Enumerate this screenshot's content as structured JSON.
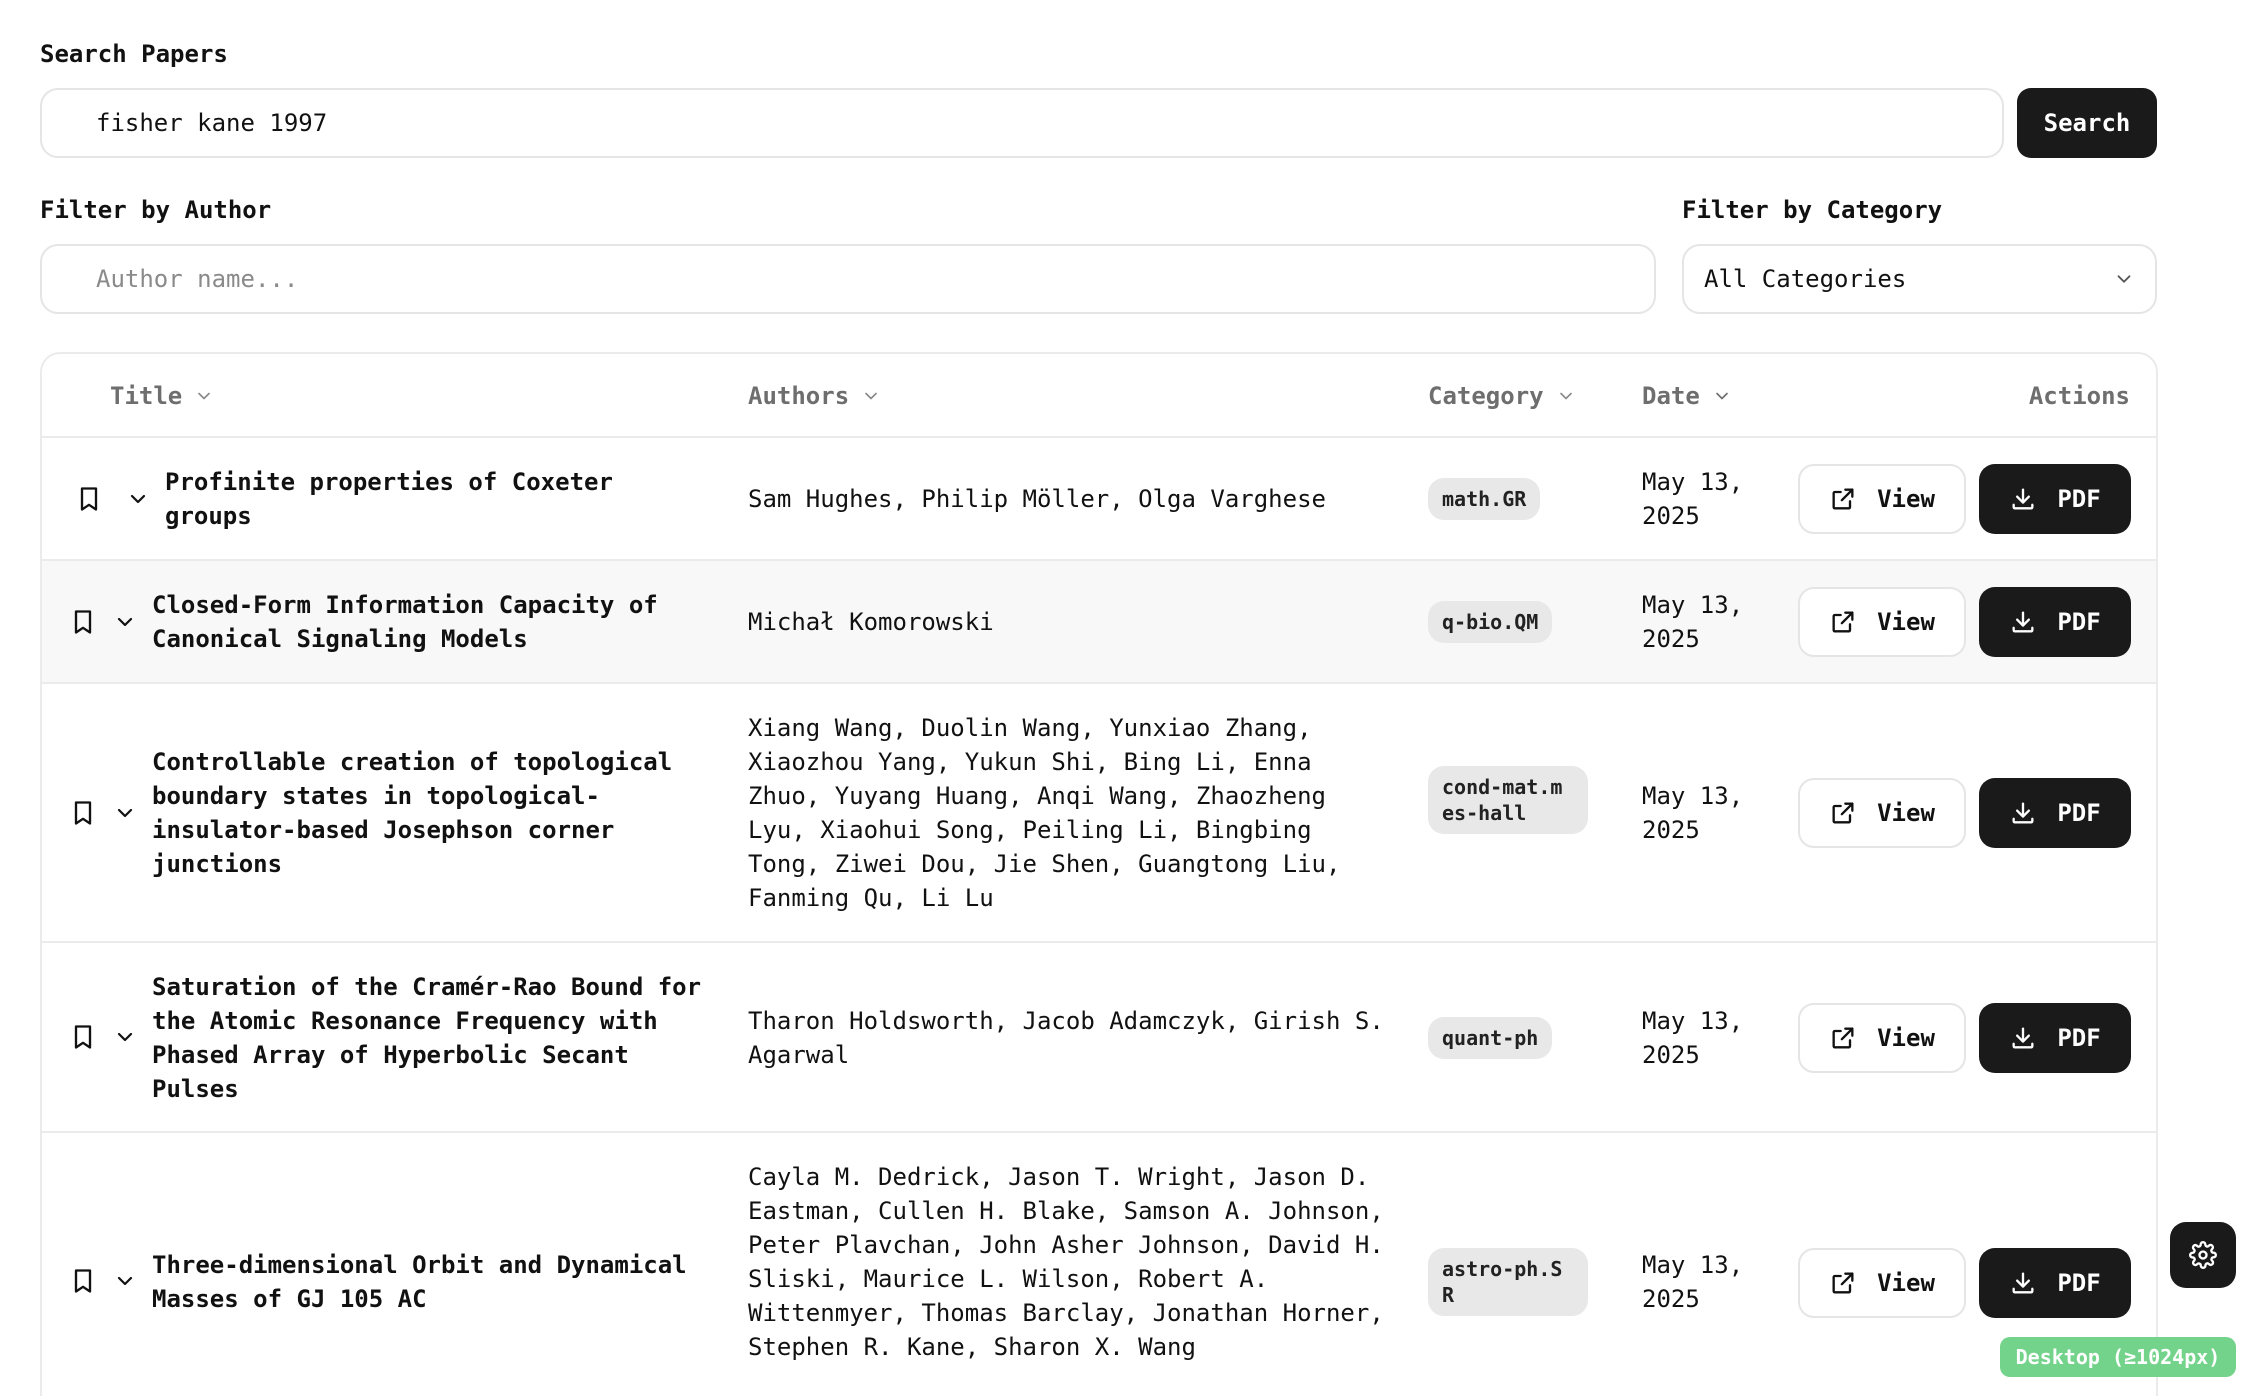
{
  "search": {
    "label": "Search Papers",
    "value": "fisher kane 1997",
    "button_label": "Search"
  },
  "filters": {
    "author_label": "Filter by Author",
    "author_placeholder": "Author name...",
    "author_value": "",
    "category_label": "Filter by Category",
    "category_selected": "All Categories"
  },
  "table": {
    "headers": {
      "title": "Title",
      "authors": "Authors",
      "category": "Category",
      "date": "Date",
      "actions": "Actions"
    },
    "view_label": "View",
    "pdf_label": "PDF",
    "rows": [
      {
        "title": "Profinite properties of Coxeter groups",
        "authors": "Sam Hughes, Philip Möller, Olga Varghese",
        "category": "math.GR",
        "date": "May 13, 2025"
      },
      {
        "title": "Closed-Form Information Capacity of Canonical Signaling Models",
        "authors": "Michał Komorowski",
        "category": "q-bio.QM",
        "date": "May 13, 2025"
      },
      {
        "title": "Controllable creation of topological boundary states in topological-insulator-based Josephson corner junctions",
        "authors": "Xiang Wang, Duolin Wang, Yunxiao Zhang, Xiaozhou Yang, Yukun Shi, Bing Li, Enna Zhuo, Yuyang Huang, Anqi Wang, Zhaozheng Lyu, Xiaohui Song, Peiling Li, Bingbing Tong, Ziwei Dou, Jie Shen, Guangtong Liu, Fanming Qu, Li Lu",
        "category": "cond-mat.mes-hall",
        "date": "May 13, 2025"
      },
      {
        "title": "Saturation of the Cramér-Rao Bound for the Atomic Resonance Frequency with Phased Array of Hyperbolic Secant Pulses",
        "authors": "Tharon Holdsworth, Jacob Adamczyk, Girish S. Agarwal",
        "category": "quant-ph",
        "date": "May 13, 2025"
      },
      {
        "title": "Three-dimensional Orbit and Dynamical Masses of GJ 105 AC",
        "authors": "Cayla M. Dedrick, Jason T. Wright, Jason D. Eastman, Cullen H. Blake, Samson A. Johnson, Peter Plavchan, John Asher Johnson, David H. Sliski, Maurice L. Wilson, Robert A. Wittenmyer, Thomas Barclay, Jonathan Horner, Stephen R. Kane, Sharon X. Wang",
        "category": "astro-ph.SR",
        "date": "May 13, 2025"
      }
    ]
  },
  "viewport_badge": "Desktop (≥1024px)",
  "icons": {
    "bookmark": "bookmark-icon",
    "expand": "chevron-down-icon",
    "view": "external-link-icon",
    "pdf": "download-icon",
    "settings": "gear-icon"
  },
  "colors": {
    "primary": "#1a1a1a",
    "badge_bg": "#e8e8e8",
    "viewport_badge": "#74d38b"
  }
}
